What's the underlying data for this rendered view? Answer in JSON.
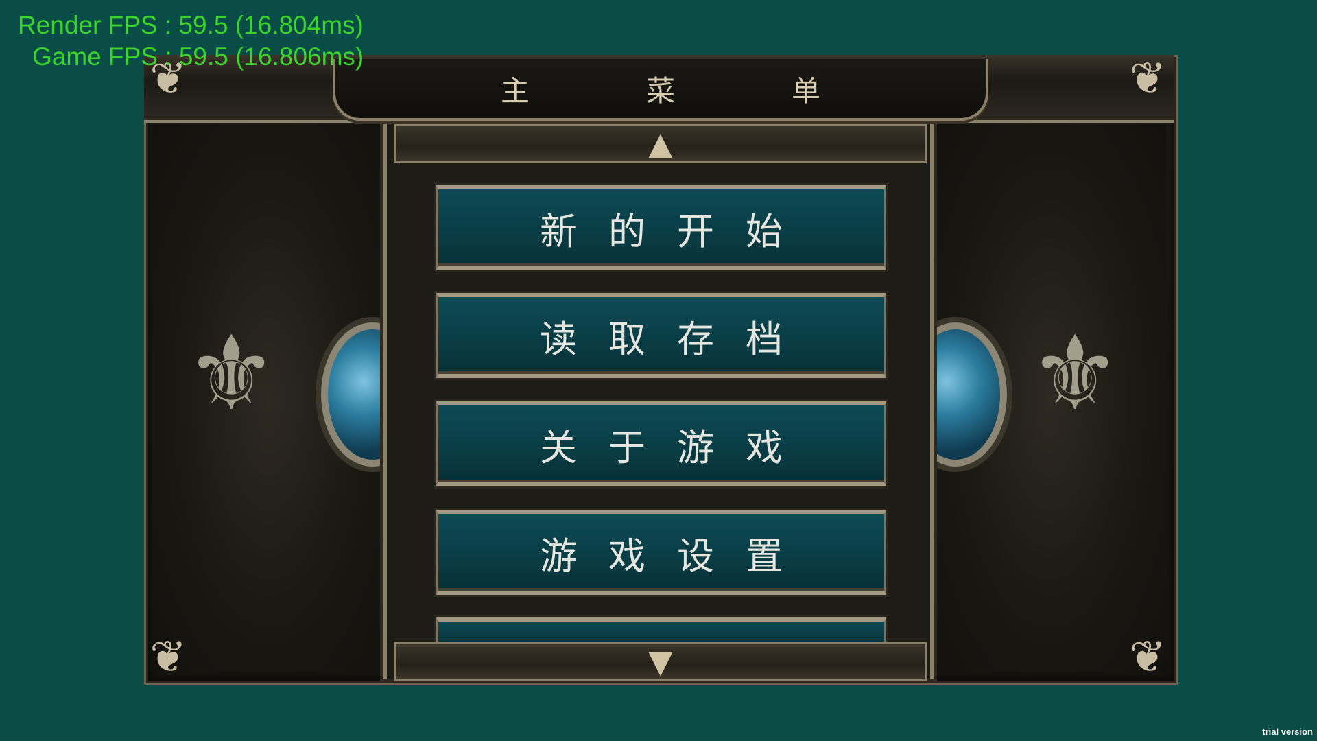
{
  "overlay": {
    "render_fps": "Render FPS : 59.5 (16.804ms)",
    "game_fps": "Game FPS : 59.5 (16.806ms)",
    "trial": "trial version"
  },
  "menu": {
    "title": "主菜单",
    "items": [
      {
        "label": "新的开始"
      },
      {
        "label": "读取存档"
      },
      {
        "label": "关于游戏"
      },
      {
        "label": "游戏设置"
      },
      {
        "label": ""
      }
    ]
  },
  "colors": {
    "background": "#0a4d47",
    "fps_text": "#3bd42c",
    "button_fill": "#0d4a54",
    "frame_metal": "#8d8169",
    "gem": "#2c7ea0"
  },
  "icons": {
    "scroll_up": "triangle-up-icon",
    "scroll_down": "triangle-down-icon",
    "corner": "fleur-ornament-icon"
  }
}
